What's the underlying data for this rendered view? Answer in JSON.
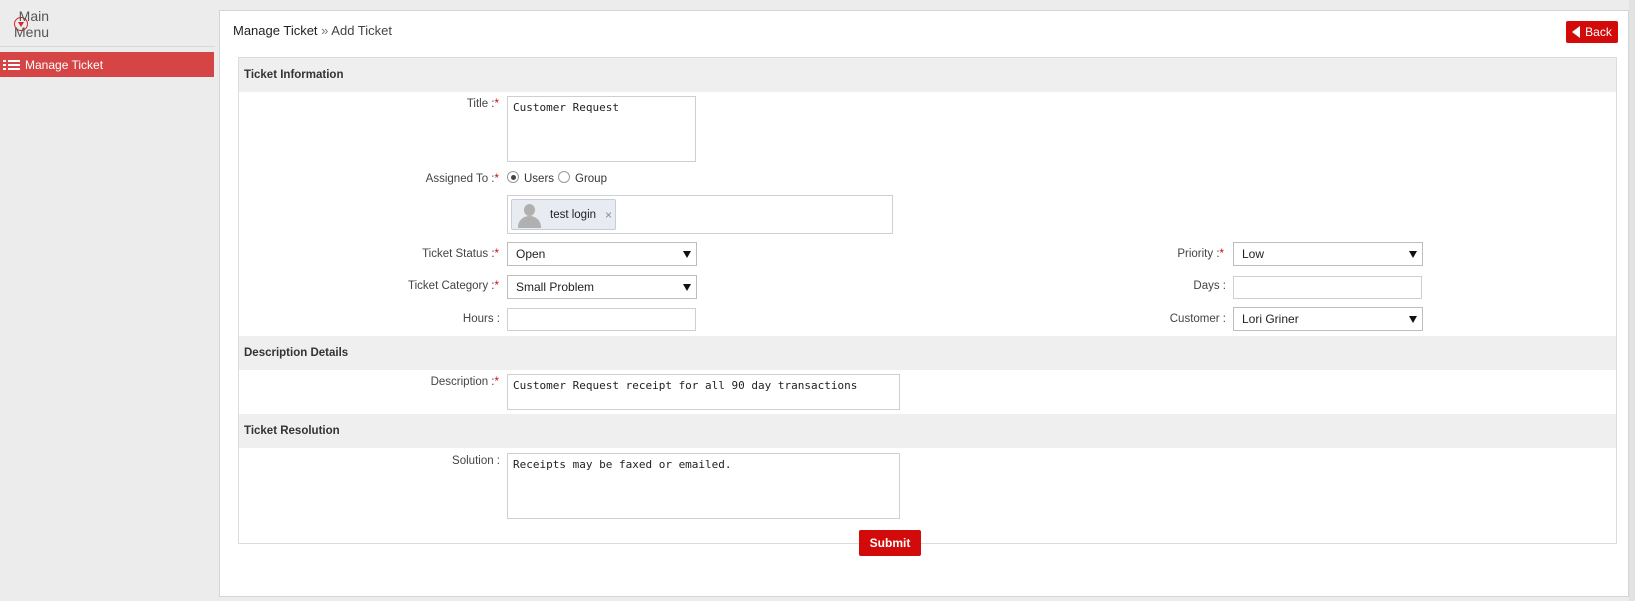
{
  "sidebar": {
    "main_menu_label": "Main Menu",
    "items": [
      {
        "label": "Manage Ticket",
        "active": true,
        "icon": "list-icon"
      }
    ]
  },
  "header": {
    "crumb_parent": "Manage Ticket",
    "crumb_sep": " » ",
    "crumb_current": "Add Ticket",
    "back_label": "Back"
  },
  "sections": {
    "ticket_info": "Ticket Information",
    "description": "Description Details",
    "resolution": "Ticket Resolution"
  },
  "labels": {
    "title": "Title :",
    "assigned_to": "Assigned To :",
    "ticket_status": "Ticket Status :",
    "ticket_category": "Ticket Category :",
    "hours": "Hours :",
    "priority": "Priority :",
    "days": "Days :",
    "customer": "Customer :",
    "description": "Description :",
    "solution": "Solution :",
    "required_marker": "*"
  },
  "fields": {
    "title": "Customer Request",
    "assigned_to_options": {
      "users": "Users",
      "group": "Group",
      "selected": "Users"
    },
    "assigned_user": "test login",
    "assigned_user_remove": "×",
    "ticket_status": "Open",
    "ticket_category": "Small Problem",
    "hours": "",
    "priority": "Low",
    "days": "",
    "customer": "Lori Griner",
    "description": "Customer Request receipt for all 90 day transactions",
    "solution": "Receipts may be faxed or emailed."
  },
  "actions": {
    "submit_label": "Submit"
  },
  "colors": {
    "accent": "#d20a0a",
    "sidebar_active": "#d64545",
    "section_bg": "#efefef"
  }
}
